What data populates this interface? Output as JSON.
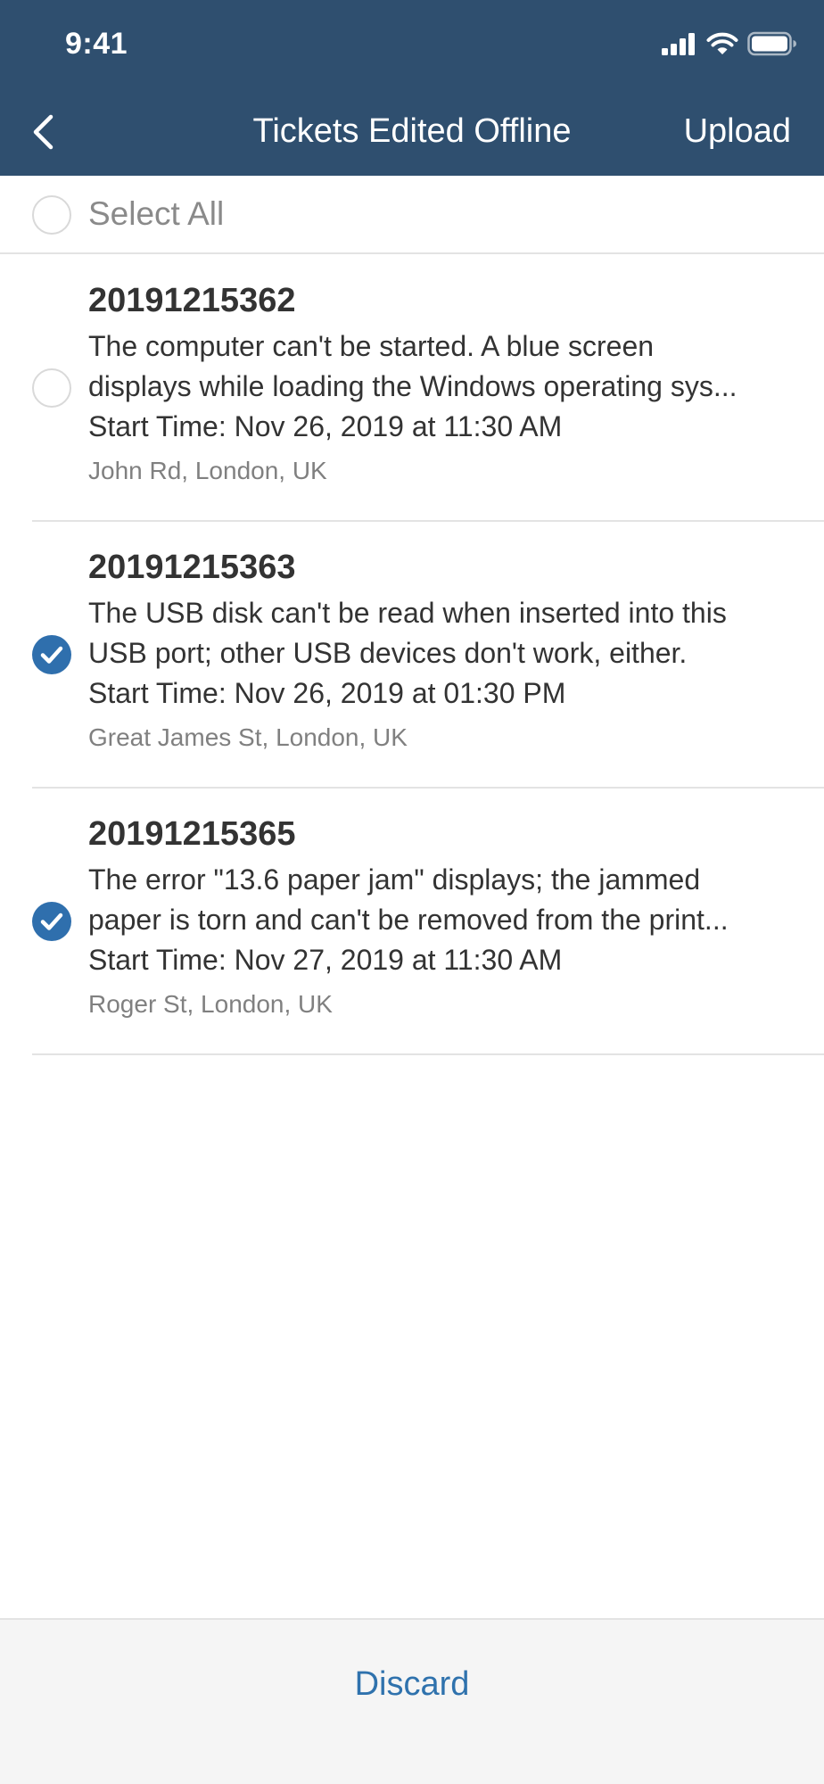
{
  "status_bar": {
    "time": "9:41",
    "icons": [
      "signal-icon",
      "wifi-icon",
      "battery-icon"
    ]
  },
  "nav": {
    "back_icon": "chevron-left-icon",
    "title": "Tickets Edited Offline",
    "upload_label": "Upload"
  },
  "select_all": {
    "label": "Select All",
    "checked": false
  },
  "tickets": [
    {
      "id": "20191215362",
      "description_line1": "The computer can't be started. A blue screen",
      "description_line2": "displays while loading the Windows operating sys...",
      "start_time": "Start Time: Nov 26, 2019 at 11:30 AM",
      "location": "John Rd, London, UK",
      "checked": false
    },
    {
      "id": "20191215363",
      "description_line1": "The USB disk can't be read when inserted into this",
      "description_line2": "USB port; other USB devices don't work, either.",
      "start_time": "Start Time: Nov 26, 2019 at 01:30 PM",
      "location": "Great James St, London, UK",
      "checked": true
    },
    {
      "id": "20191215365",
      "description_line1": "The error \"13.6 paper jam\" displays; the jammed",
      "description_line2": "paper is torn and can't be removed from the print...",
      "start_time": "Start Time: Nov 27, 2019 at 11:30 AM",
      "location": "Roger St, London, UK",
      "checked": true
    }
  ],
  "footer": {
    "discard_label": "Discard"
  },
  "colors": {
    "header_bg": "#2f4f6f",
    "accent_blue": "#2f6fad",
    "divider": "#e3e3e3"
  }
}
